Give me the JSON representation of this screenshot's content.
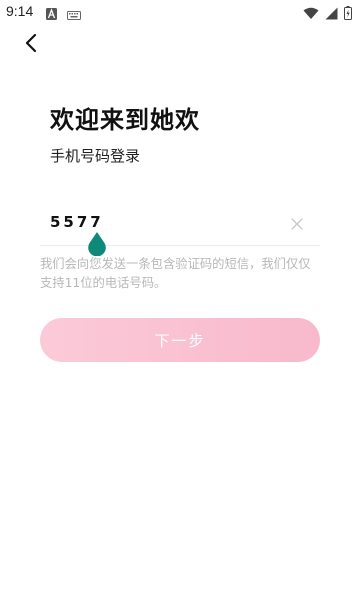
{
  "status_bar": {
    "time": "9:14",
    "icons": [
      "font-a-icon",
      "keyboard-icon",
      "wifi-icon",
      "signal-icon",
      "battery-charging-icon"
    ]
  },
  "header": {
    "back_icon": "chevron-left-icon"
  },
  "login": {
    "title": "欢迎来到她欢",
    "subtitle": "手机号码登录",
    "phone_value": "5577",
    "clear_icon": "close-icon",
    "hint": "我们会向您发送一条包含验证码的短信，我们仅仅支持11位的电话号码。",
    "next_label": "下一步"
  },
  "colors": {
    "accent_start": "#fbcad8",
    "accent_end": "#f8b9cc",
    "cursor_handle": "#0f8a7a",
    "hint_text": "#b8b8b8"
  }
}
